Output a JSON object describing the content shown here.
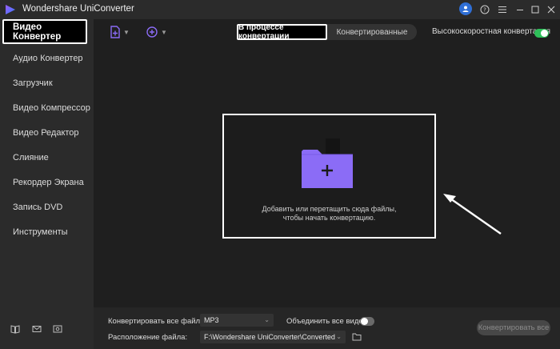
{
  "window": {
    "title": "Wondershare UniConverter"
  },
  "sidebar": {
    "items": [
      {
        "label": "Видео Конвертер",
        "active": true
      },
      {
        "label": "Аудио Конвертер"
      },
      {
        "label": "Загрузчик"
      },
      {
        "label": "Видео Компрессор"
      },
      {
        "label": "Видео Редактор"
      },
      {
        "label": "Слияние"
      },
      {
        "label": "Рекордер Экрана"
      },
      {
        "label": "Запись DVD"
      },
      {
        "label": "Инструменты"
      }
    ],
    "bottom_icons": [
      "book-icon",
      "mail-icon",
      "feedback-icon"
    ]
  },
  "toolbar": {
    "add_files_icon": "add-file-icon",
    "add_media_icon": "add-media-icon",
    "tab_converting": "В процессе конвертации",
    "tab_converted": "Конвертированные",
    "high_speed_label": "Высокоскоростная конвертация",
    "high_speed_on": true
  },
  "drop_zone": {
    "line1": "Добавить или перетащить сюда файлы,",
    "line2": "чтобы начать конвертацию."
  },
  "bottom": {
    "convert_all_label": "Конвертировать все файлы в:",
    "format_value": "MP3",
    "merge_label": "Объединить все видео",
    "merge_on": false,
    "location_label": "Расположение файла:",
    "location_value": "F:\\Wondershare UniConverter\\Converted",
    "convert_all_button": "Конвертировать все"
  },
  "colors": {
    "accent": "#2fbf5a",
    "folder": "#8b6cf6",
    "user_badge": "#2f6fd6"
  }
}
